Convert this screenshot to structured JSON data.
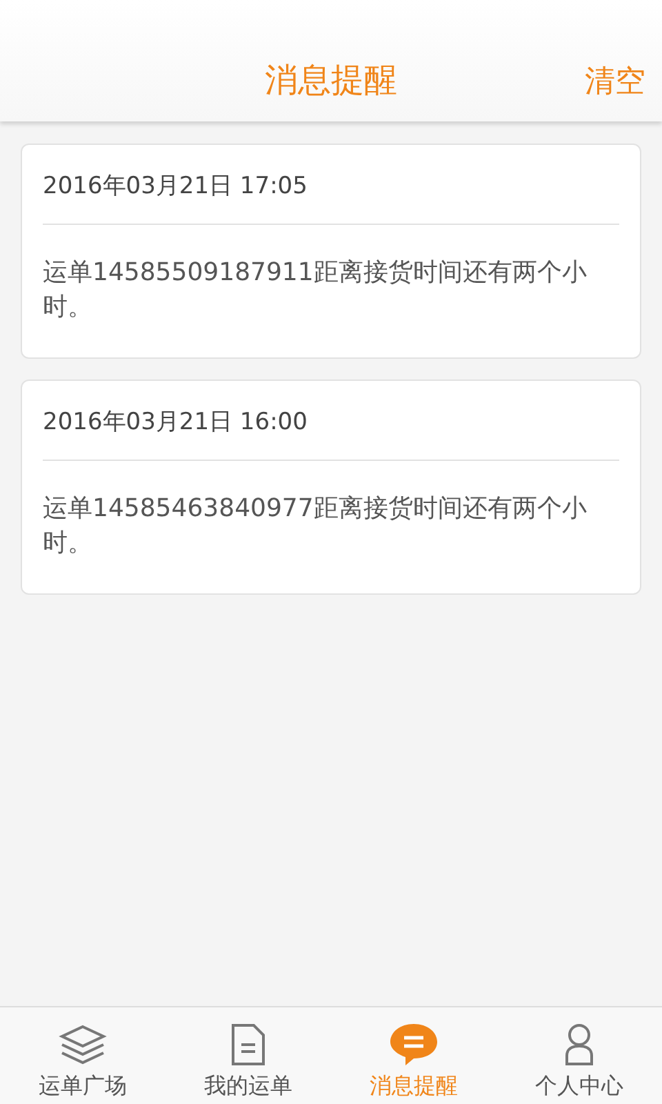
{
  "header": {
    "title": "消息提醒",
    "action": "清空"
  },
  "messages": [
    {
      "time": "2016年03月21日 17:05",
      "text": "运单14585509187911距离接货时间还有两个小时。"
    },
    {
      "time": "2016年03月21日 16:00",
      "text": "运单14585463840977距离接货时间还有两个小时。"
    }
  ],
  "tabs": [
    {
      "kind": "layers",
      "label": "运单广场",
      "selected": false
    },
    {
      "kind": "document",
      "label": "我的运单",
      "selected": false
    },
    {
      "kind": "chat",
      "label": "消息提醒",
      "selected": true
    },
    {
      "kind": "person",
      "label": "个人中心",
      "selected": false
    }
  ]
}
